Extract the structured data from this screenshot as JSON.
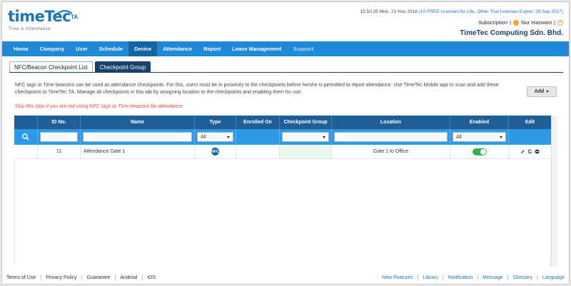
{
  "logo": {
    "brand": "timeTec",
    "superscript": "TA",
    "tagline": "Time & Attendance"
  },
  "topbar": {
    "datetime": "15:50:25 Mon. 21 Nov 2016",
    "license_text": "(10-FREE Licenses for Life, Other Trial Licenses Expire: 28 Sep 2017)",
    "subscription": "Subscription",
    "separator": "|",
    "user": "Nur Hazwani",
    "company": "TimeTec Computing Sdn. Bhd."
  },
  "nav": {
    "items": [
      {
        "label": "Home"
      },
      {
        "label": "Company"
      },
      {
        "label": "User"
      },
      {
        "label": "Schedule"
      },
      {
        "label": "Device"
      },
      {
        "label": "Attendance"
      },
      {
        "label": "Report"
      },
      {
        "label": "Leave Management"
      },
      {
        "label": "Support"
      }
    ]
  },
  "tabs": [
    {
      "label": "NFC/Beacon Checkpoint List"
    },
    {
      "label": "Checkpoint Group"
    }
  ],
  "description": "NFC tags or Time beacons can be used as attendance checkpoints. For this, users must be in proximity to the checkpoints before he/she is permitted to report attendance. Use TimeTec Mobile app to scan and add these checkpoints to TimeTec TA. Manage all checkpoints in this tab by assigning location to the checkpoints and enabling them for use.",
  "warning": "Skip this step if you are not using NFC tags or Time beacons for attendance.",
  "add_button": "Add",
  "table": {
    "headers": [
      "",
      "ID No.",
      "Name",
      "Type",
      "Enrolled On",
      "Checkpoint Group",
      "Location",
      "Enabled",
      "Edit"
    ],
    "filters": {
      "type_value": "All",
      "enabled_value": "All"
    },
    "rows": [
      {
        "id": "11",
        "name": "Attendance Gate 1",
        "type_icon": "nfc-icon",
        "enrolled_on": "",
        "group": "",
        "location": "Gate 1 to Office",
        "enabled": true
      }
    ]
  },
  "footer": {
    "left": [
      "Terms of Use",
      "Privacy Policy",
      "Guarantee",
      "Android",
      "iOS"
    ],
    "right": [
      "New Features",
      "Library",
      "Notification",
      "Message",
      "Glossary",
      "Language"
    ],
    "separator": "|"
  },
  "colors": {
    "brand_blue": "#1c74b9",
    "nav_bg": "#1f88d9",
    "nav_active": "#1565a6",
    "table_header": "#1e5f9a",
    "filter_row": "#2d9ae5",
    "warning": "#e04a4a",
    "toggle_on": "#2fb24c"
  }
}
